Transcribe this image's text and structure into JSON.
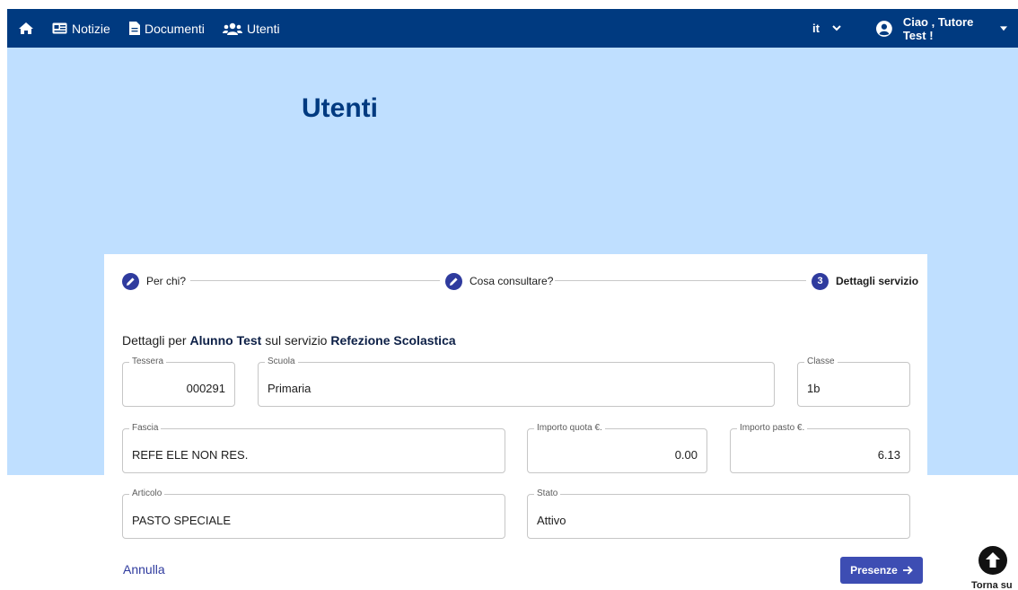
{
  "navbar": {
    "items": [
      {
        "label": "Notizie",
        "icon": "newspaper-icon"
      },
      {
        "label": "Documenti",
        "icon": "document-icon"
      },
      {
        "label": "Utenti",
        "icon": "users-icon"
      }
    ],
    "language": "it",
    "greeting": "Ciao , Tutore Test !"
  },
  "hero": {
    "title": "Utenti"
  },
  "stepper": {
    "steps": [
      {
        "label": "Per chi?",
        "marker": "pencil-icon"
      },
      {
        "label": "Cosa consultare?",
        "marker": "pencil-icon"
      },
      {
        "label": "Dettagli servizio",
        "number": "3"
      }
    ]
  },
  "details": {
    "prefix": "Dettagli per",
    "student": "Alunno Test",
    "middle": "sul servizio",
    "service": "Refezione Scolastica"
  },
  "fields": {
    "tessera": {
      "label": "Tessera",
      "value": "000291"
    },
    "scuola": {
      "label": "Scuola",
      "value": "Primaria"
    },
    "classe": {
      "label": "Classe",
      "value": "1b"
    },
    "fascia": {
      "label": "Fascia",
      "value": "REFE ELE NON RES."
    },
    "importo_quota": {
      "label": "Importo quota €.",
      "value": "0.00"
    },
    "importo_pasto": {
      "label": "Importo pasto €.",
      "value": "6.13"
    },
    "articolo": {
      "label": "Articolo",
      "value": "PASTO SPECIALE"
    },
    "stato": {
      "label": "Stato",
      "value": "Attivo"
    }
  },
  "actions": {
    "cancel": "Annulla",
    "next": "Presenze"
  },
  "back_to_top": "Torna su",
  "colors": {
    "navbar": "#003a80",
    "hero": "#bfdfff",
    "accent": "#2f3b9e",
    "button": "#3d4db3"
  }
}
